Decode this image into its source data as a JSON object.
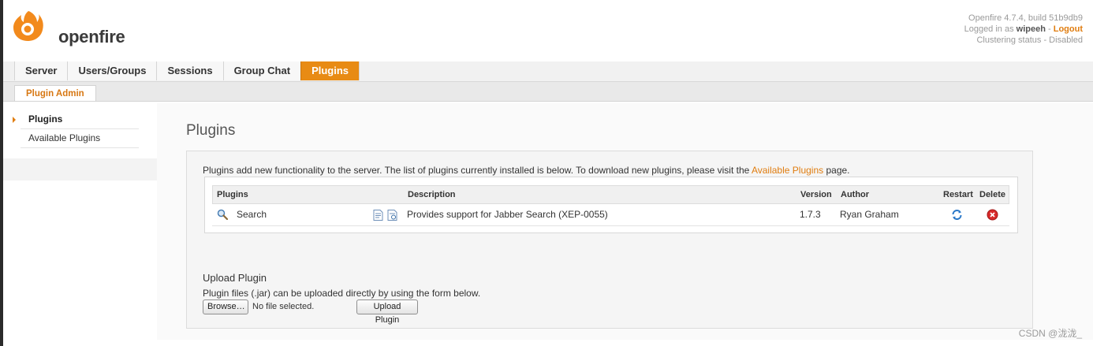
{
  "header": {
    "logo_text": "openfire",
    "version_line": "Openfire 4.7.4, build 51b9db9",
    "logged_in_prefix": "Logged in as ",
    "username": "wipeeh",
    "separator": " - ",
    "logout_label": "Logout",
    "clustering_status": "Clustering status - Disabled"
  },
  "nav": {
    "tabs": [
      {
        "label": "Server"
      },
      {
        "label": "Users/Groups"
      },
      {
        "label": "Sessions"
      },
      {
        "label": "Group Chat"
      },
      {
        "label": "Plugins",
        "active": true
      }
    ]
  },
  "subnav": {
    "label": "Plugin Admin"
  },
  "sidebar": {
    "items": [
      {
        "label": "Plugins",
        "active": true
      },
      {
        "label": "Available Plugins"
      }
    ]
  },
  "main": {
    "title": "Plugins",
    "intro_text": "Plugins add new functionality to the server. The list of plugins currently installed is below. To download new plugins, please visit the ",
    "intro_link": "Available Plugins",
    "intro_suffix": " page.",
    "table": {
      "headers": {
        "plugins": "Plugins",
        "description": "Description",
        "version": "Version",
        "author": "Author",
        "restart": "Restart",
        "delete": "Delete"
      },
      "rows": [
        {
          "name": "Search",
          "description": "Provides support for Jabber Search (XEP-0055)",
          "version": "1.7.3",
          "author": "Ryan Graham"
        }
      ]
    },
    "upload": {
      "title": "Upload Plugin",
      "description": "Plugin files (.jar) can be uploaded directly by using the form below.",
      "browse_label": "Browse…",
      "file_status": "No file selected.",
      "upload_label": "Upload Plugin"
    }
  },
  "watermark": "CSDN @泷泷_",
  "colors": {
    "accent": "#e88b14",
    "link": "#e07d10"
  },
  "icons": [
    "openfire-logo-icon",
    "search-icon",
    "readme-icon",
    "changelog-icon",
    "restart-icon",
    "delete-icon",
    "nav-arrow-icon"
  ]
}
